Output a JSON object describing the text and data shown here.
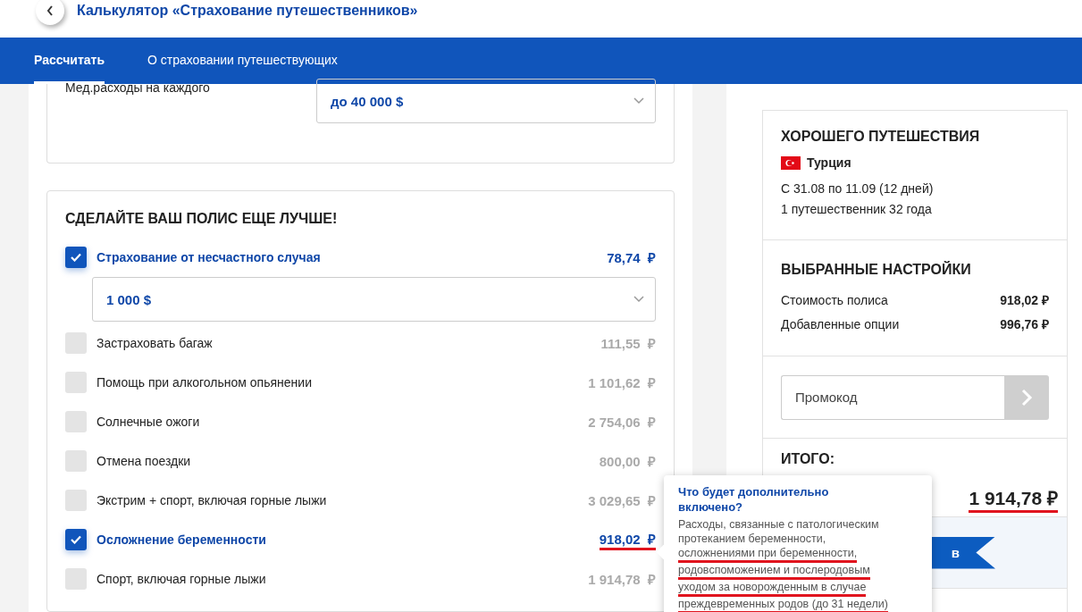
{
  "header": {
    "title": "Калькулятор «Страхование путешественников»"
  },
  "tabs": [
    {
      "label": "Рассчитать",
      "selected": true
    },
    {
      "label": "О страховании путешествующих",
      "selected": false
    }
  ],
  "medical": {
    "label": "Мед.расходы на каждого",
    "value": "до 40 000 $"
  },
  "options": {
    "title": "СДЕЛАЙТЕ ВАШ ПОЛИС ЕЩЕ ЛУЧШЕ!",
    "items": [
      {
        "label": "Страхование от несчастного случая",
        "price": "78,74",
        "currency": "₽",
        "checked": true,
        "underlined": false,
        "select": "1 000 $"
      },
      {
        "label": "Застраховать багаж",
        "price": "111,55",
        "currency": "₽",
        "checked": false,
        "underlined": false
      },
      {
        "label": "Помощь при алкогольном опьянении",
        "price": "1 101,62",
        "currency": "₽",
        "checked": false,
        "underlined": false
      },
      {
        "label": "Солнечные ожоги",
        "price": "2 754,06",
        "currency": "₽",
        "checked": false,
        "underlined": false
      },
      {
        "label": "Отмена поездки",
        "price": "800,00",
        "currency": "₽",
        "checked": false,
        "underlined": false
      },
      {
        "label": "Экстрим + спорт, включая горные лыжи",
        "price": "3 029,65",
        "currency": "₽",
        "checked": false,
        "underlined": false
      },
      {
        "label": "Осложнение беременности",
        "price": "918,02",
        "currency": "₽",
        "checked": true,
        "underlined": true
      },
      {
        "label": "Спорт, включая горные лыжи",
        "price": "1 914,78",
        "currency": "₽",
        "checked": false,
        "underlined": false
      }
    ]
  },
  "summary": {
    "title": "ХОРОШЕГО ПУТЕШЕСТВИЯ",
    "country": "Турция",
    "dates": "С 31.08 по 11.09 (12 дней)",
    "travellers": "1 путешественник 32 года"
  },
  "settings": {
    "title": "ВЫБРАННЫЕ НАСТРОЙКИ",
    "rows": [
      {
        "label": "Стоимость полиса",
        "value": "918,02 ₽"
      },
      {
        "label": "Добавленные опции",
        "value": "996,76 ₽"
      }
    ]
  },
  "promo": {
    "placeholder": "Промокод"
  },
  "total": {
    "label": "ИТОГО:",
    "value": "1 914,78 ₽",
    "underlined": true
  },
  "buy_button": {
    "label": "в"
  },
  "tooltip": {
    "title": "Что будет дополнительно включено?",
    "lines": [
      {
        "text": "Расходы, связанные с патологическим",
        "underlined": false
      },
      {
        "text": "протеканием беременности,",
        "underlined": false
      },
      {
        "text": "осложнениями при беременности,",
        "underlined": true
      },
      {
        "text": "родовспоможением и послеродовым",
        "underlined": true
      },
      {
        "text": "уходом за новорожденным в случае",
        "underlined": true
      },
      {
        "text": "преждевременных родов (до 31 недели)",
        "underlined": true
      }
    ]
  }
}
